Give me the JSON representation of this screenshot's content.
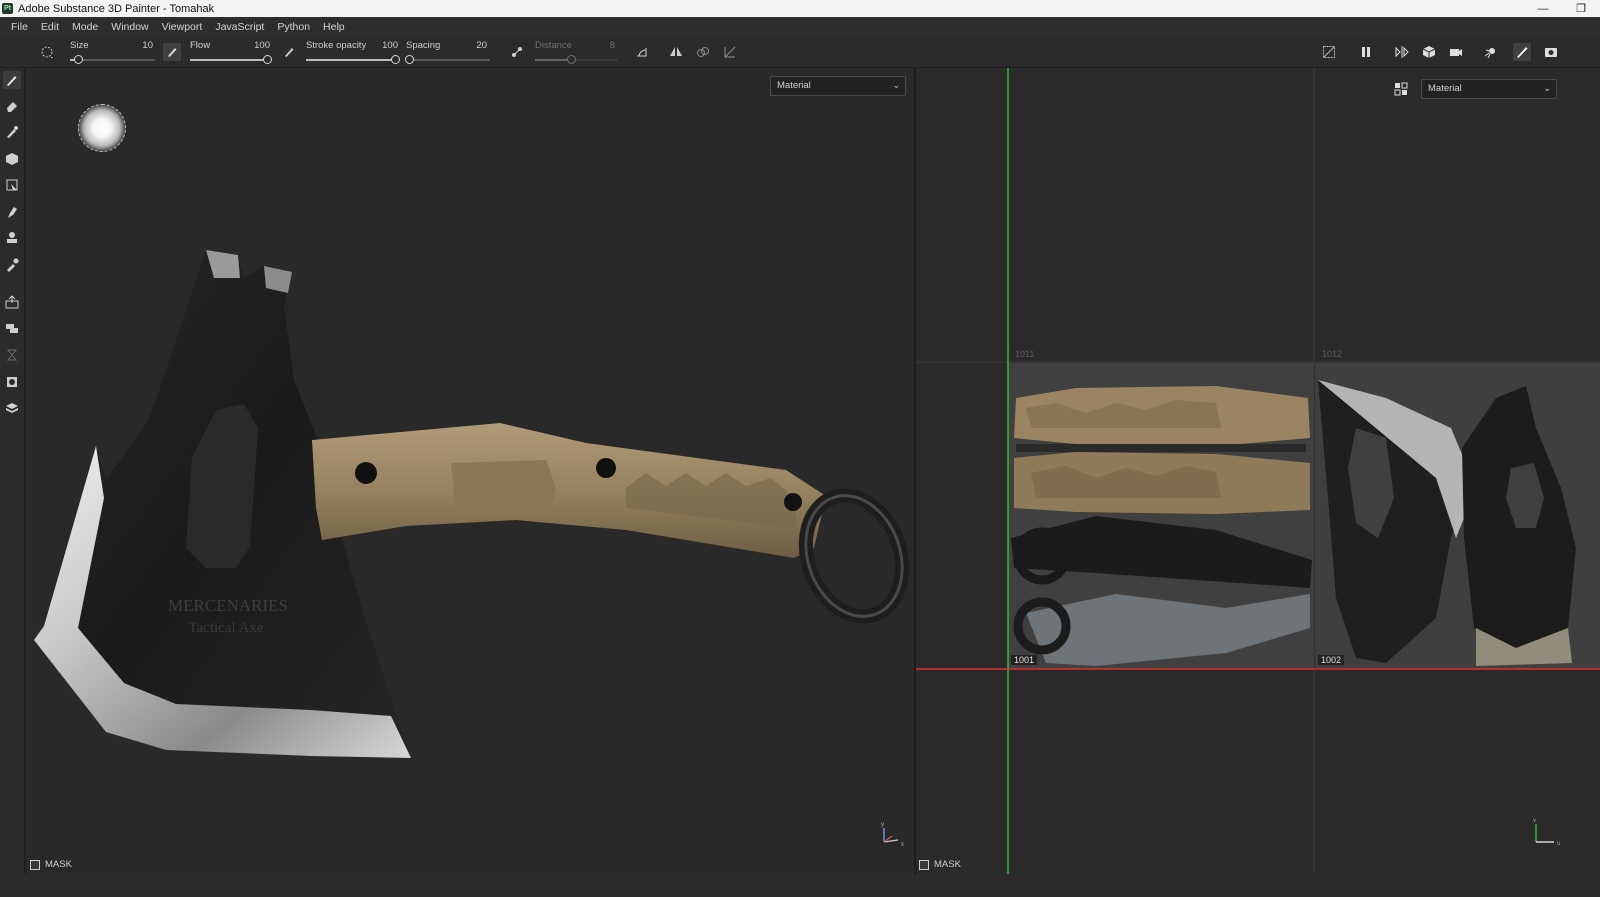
{
  "window": {
    "app_icon": "Pt",
    "title": "Adobe Substance 3D Painter - Tomahak",
    "controls": {
      "minimize": "—",
      "restore": "❐"
    }
  },
  "menu": [
    "File",
    "Edit",
    "Mode",
    "Window",
    "Viewport",
    "JavaScript",
    "Python",
    "Help"
  ],
  "toolbar": {
    "size": {
      "label": "Size",
      "value": "10",
      "fraction": 0.1
    },
    "flow": {
      "label": "Flow",
      "value": "100",
      "fraction": 1.0
    },
    "stroke_opacity": {
      "label": "Stroke opacity",
      "value": "100",
      "fraction": 1.0
    },
    "spacing": {
      "label": "Spacing",
      "value": "20",
      "fraction": 0.05
    },
    "distance": {
      "label": "Distance",
      "value": "8",
      "fraction": 0.45,
      "disabled": true
    },
    "icons": [
      "brush-shape-icon",
      "pressure-icon",
      "alignment-icon",
      "lazy-mouse-icon",
      "angle-icon",
      "symmetry-icon",
      "symmetry-mirror-icon",
      "symmetry-axis-icon",
      "hide-icon",
      "pause-icon",
      "split-view-icon",
      "cube-icon",
      "camera-icon",
      "light-icon",
      "paint-mode-icon",
      "screenshot-icon"
    ]
  },
  "left_tools": [
    "paint-brush-icon",
    "eraser-icon",
    "projection-icon",
    "polygon-fill-icon",
    "geometry-mask-icon",
    "smudge-icon",
    "clone-icon",
    "color-picker-icon",
    "bake-icon",
    "quick-mask-icon",
    "mask-layer-icon",
    "layer-export-icon",
    "3d-view-icon"
  ],
  "viewport3d": {
    "channel_dropdown": "Material",
    "mask_label": "MASK",
    "engraving_line1": "MERCENARIES",
    "engraving_line2": "Tactical Axe",
    "gizmo": {
      "y": "y",
      "x": "x"
    }
  },
  "viewport2d": {
    "channel_dropdown": "Material",
    "mask_label": "MASK",
    "udims": [
      "1011",
      "1012",
      "1001",
      "1002"
    ],
    "gizmo": {
      "v": "v",
      "u": "u"
    }
  },
  "colors": {
    "uv_u_axis": "#d93030",
    "uv_v_axis": "#2ec22e",
    "handle_tan": "#9a8462",
    "steel": "#1f1f1f"
  }
}
